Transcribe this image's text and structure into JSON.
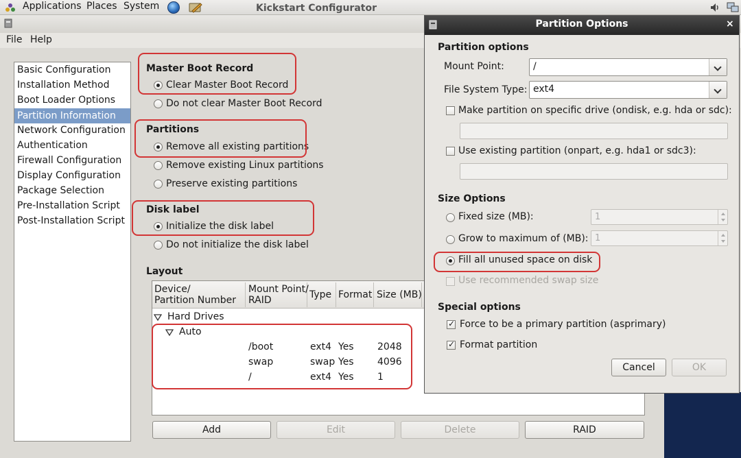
{
  "panel": {
    "menus": [
      "Applications",
      "Places",
      "System"
    ]
  },
  "window": {
    "title": "Kickstart Configurator",
    "menus": [
      "File",
      "Help"
    ]
  },
  "sidebar": {
    "items": [
      {
        "label": "Basic Configuration"
      },
      {
        "label": "Installation Method"
      },
      {
        "label": "Boot Loader Options"
      },
      {
        "label": "Partition Information",
        "selected": true
      },
      {
        "label": "Network Configuration"
      },
      {
        "label": "Authentication"
      },
      {
        "label": "Firewall Configuration"
      },
      {
        "label": "Display Configuration"
      },
      {
        "label": "Package Selection"
      },
      {
        "label": "Pre-Installation Script"
      },
      {
        "label": "Post-Installation Script"
      }
    ]
  },
  "mbr": {
    "title": "Master Boot Record",
    "clear": "Clear Master Boot Record",
    "no_clear": "Do not clear Master Boot Record",
    "selected": "clear"
  },
  "partitions": {
    "title": "Partitions",
    "remove_all": "Remove all existing partitions",
    "remove_linux": "Remove existing Linux partitions",
    "preserve": "Preserve existing partitions",
    "selected": "remove_all"
  },
  "disk_label": {
    "title": "Disk label",
    "init": "Initialize the disk label",
    "no_init": "Do not initialize the disk label",
    "selected": "init"
  },
  "layout": {
    "title": "Layout",
    "headers": {
      "device_1": "Device/",
      "device_2": "Partition Number",
      "mount_1": "Mount Point/",
      "mount_2": "RAID",
      "type": "Type",
      "format": "Format",
      "size": "Size (MB)"
    },
    "tree": {
      "root": "Hard Drives",
      "group": "Auto",
      "rows": [
        {
          "mount": "/boot",
          "type": "ext4",
          "format": "Yes",
          "size": "2048"
        },
        {
          "mount": "swap",
          "type": "swap",
          "format": "Yes",
          "size": "4096"
        },
        {
          "mount": "/",
          "type": "ext4",
          "format": "Yes",
          "size": "1"
        }
      ]
    },
    "buttons": {
      "add": "Add",
      "edit": "Edit",
      "delete": "Delete",
      "raid": "RAID"
    }
  },
  "dialog": {
    "title": "Partition Options",
    "close": "×",
    "partition_options": {
      "title": "Partition options",
      "mount_label": "Mount Point:",
      "mount_value": "/",
      "fs_label": "File System Type:",
      "fs_value": "ext4",
      "ondisk_label": "Make partition on specific drive (ondisk, e.g. hda or sdc):",
      "ondisk_checked": false,
      "ondisk_value": "",
      "onpart_label": "Use existing partition (onpart, e.g. hda1 or sdc3):",
      "onpart_checked": false,
      "onpart_value": ""
    },
    "size_options": {
      "title": "Size Options",
      "fixed_label": "Fixed size (MB):",
      "fixed_value": "1",
      "grow_label": "Grow to maximum of (MB):",
      "grow_value": "1",
      "fill_label": "Fill all unused space on disk",
      "selected": "fill",
      "swap_label": "Use recommended swap size",
      "swap_checked": false
    },
    "special_options": {
      "title": "Special options",
      "primary_label": "Force to be a primary partition (asprimary)",
      "primary_checked": true,
      "format_label": "Format partition",
      "format_checked": true
    },
    "buttons": {
      "cancel": "Cancel",
      "ok": "OK"
    }
  },
  "icons": [
    "applications-icon",
    "globe-icon",
    "pencil-icon",
    "volume-icon",
    "network-icon",
    "window-icon",
    "close-icon",
    "chevron-down-icon",
    "expander-icon"
  ],
  "colors": {
    "selection": "#7b9cc8",
    "highlight": "#d23535",
    "dialog_title": "#262626"
  }
}
